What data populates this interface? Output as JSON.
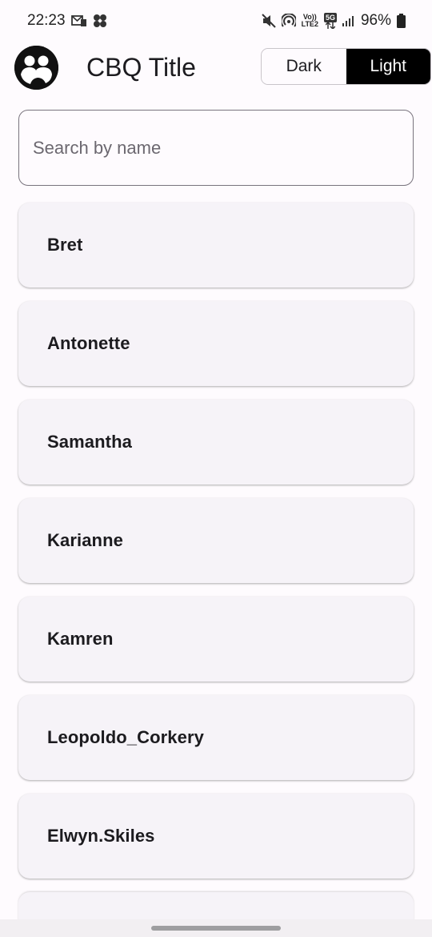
{
  "status_bar": {
    "time": "22:23",
    "net_tag_top": "Vo))",
    "net_tag_bottom": "LTE2",
    "network_5g": "5G",
    "battery": "96%"
  },
  "app_bar": {
    "title": "CBQ Title",
    "theme_toggle": {
      "dark_label": "Dark",
      "light_label": "Light",
      "selected": "Light"
    }
  },
  "search": {
    "placeholder": "Search by name",
    "value": ""
  },
  "users": [
    {
      "name": "Bret"
    },
    {
      "name": "Antonette"
    },
    {
      "name": "Samantha"
    },
    {
      "name": "Karianne"
    },
    {
      "name": "Kamren"
    },
    {
      "name": "Leopoldo_Corkery"
    },
    {
      "name": "Elwyn.Skiles"
    }
  ],
  "colors": {
    "background": "#fefbfe",
    "card": "#f6f3f8",
    "selected_toggle": "#000000",
    "text": "#1c1b1f"
  }
}
